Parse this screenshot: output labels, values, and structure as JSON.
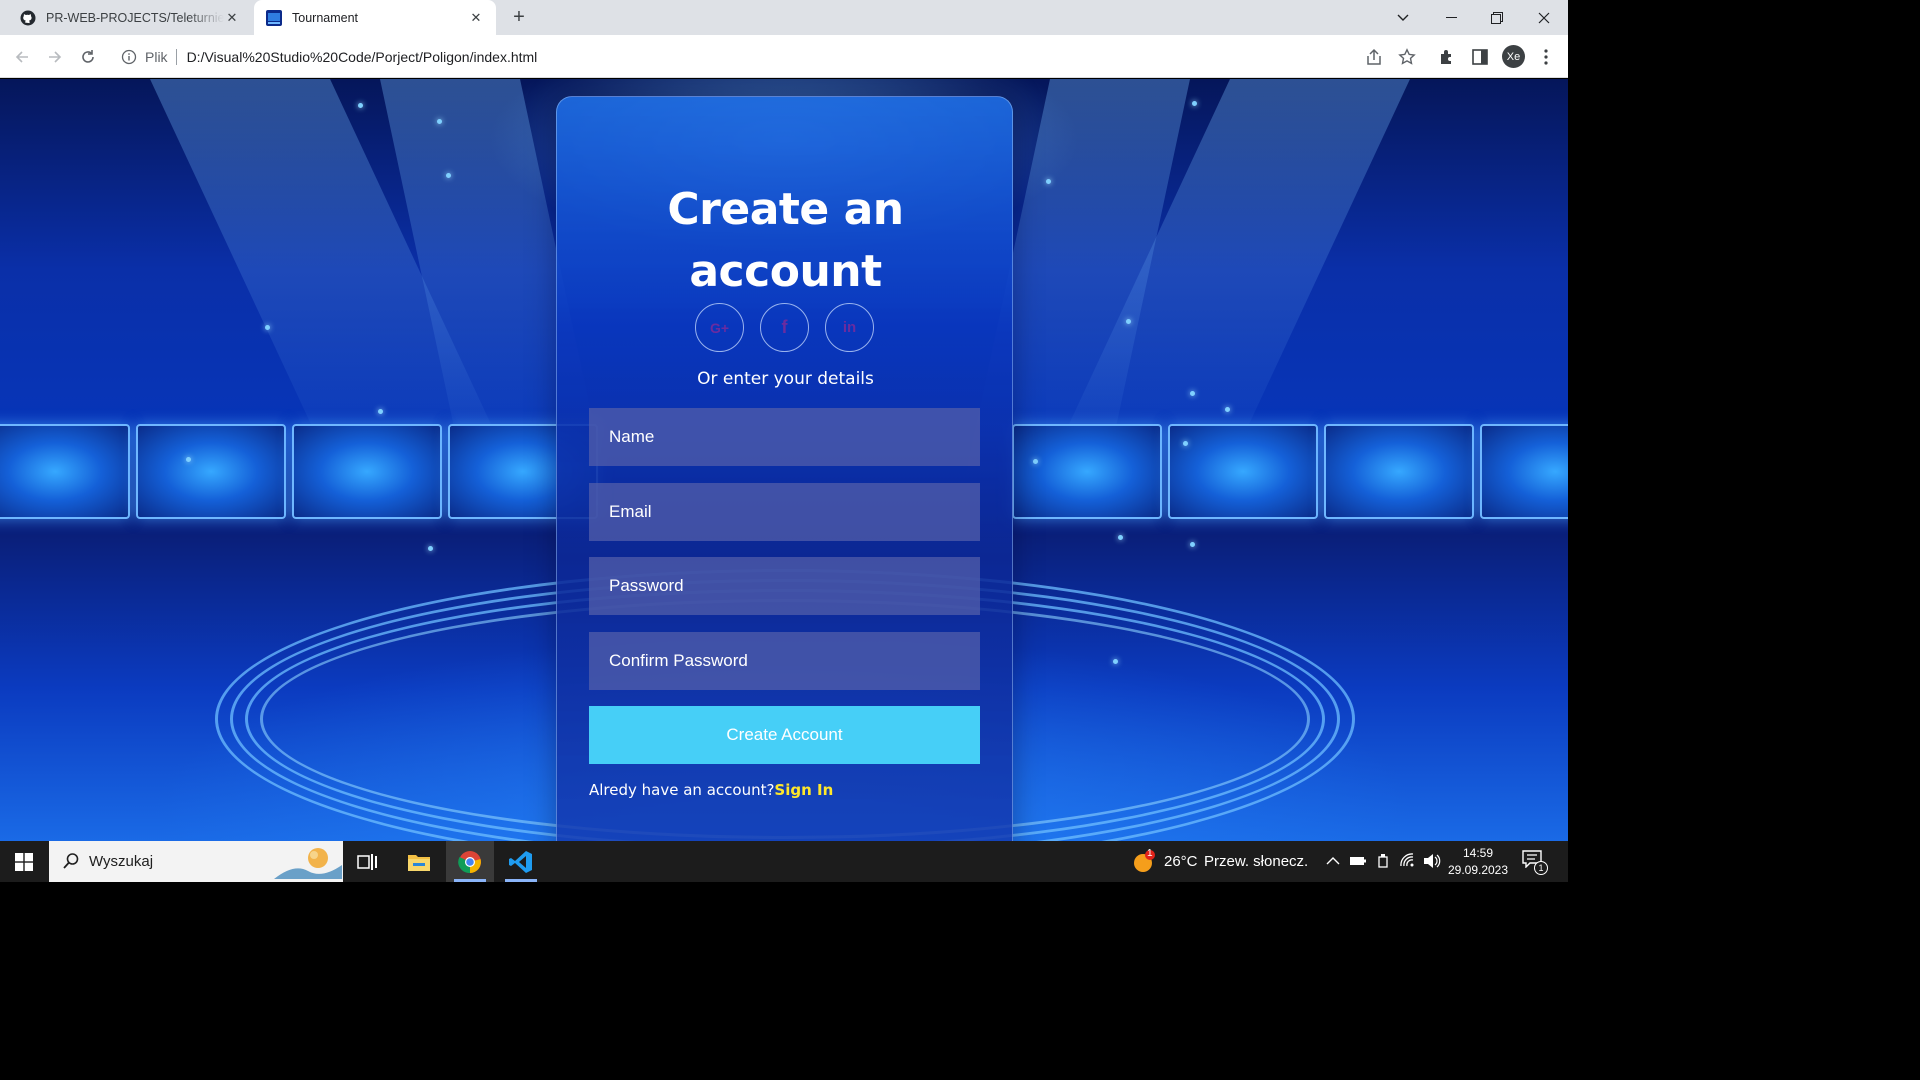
{
  "browser": {
    "tabs": [
      {
        "title": "PR-WEB-PROJECTS/Teleturniej a"
      },
      {
        "title": "Tournament"
      }
    ],
    "address": {
      "scheme_label": "Plik",
      "url": "D:/Visual%20Studio%20Code/Porject/Poligon/index.html"
    },
    "profile_initials": "Xe"
  },
  "signup": {
    "title_line1": "Create an",
    "title_line2": "account",
    "social": [
      {
        "icon": "google-plus-icon",
        "glyph": "G+"
      },
      {
        "icon": "facebook-icon",
        "glyph": "f"
      },
      {
        "icon": "linkedin-icon",
        "glyph": "in"
      }
    ],
    "subtitle": "Or enter your details",
    "fields": {
      "name_placeholder": "Name",
      "email_placeholder": "Email",
      "password_placeholder": "Password",
      "confirm_placeholder": "Confirm Password"
    },
    "submit_label": "Create Account",
    "have_account_text": "Alredy have an account?",
    "sign_in_label": "Sign In",
    "colors": {
      "button": "#46cff7",
      "link": "#ffe82a"
    }
  },
  "taskbar": {
    "search_placeholder": "Wyszukaj",
    "weather": {
      "temp": "26°C",
      "desc": "Przew. słonecz.",
      "badge": "1"
    },
    "clock": {
      "time": "14:59",
      "date": "29.09.2023"
    },
    "notifications_count": "1"
  }
}
